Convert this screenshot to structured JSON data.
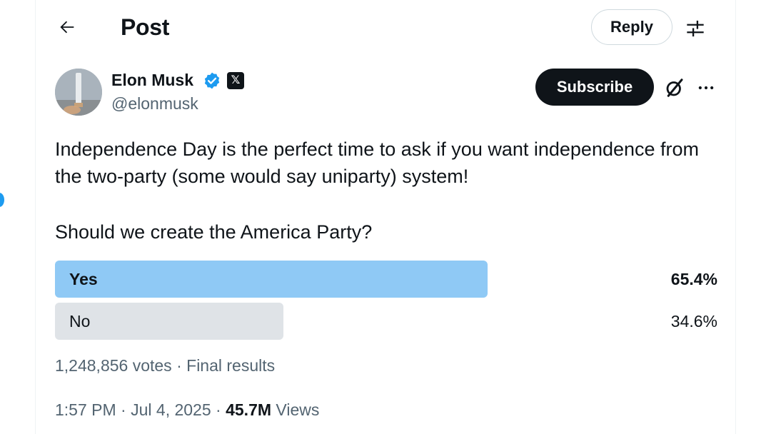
{
  "header": {
    "title": "Post",
    "reply_label": "Reply"
  },
  "author": {
    "name": "Elon Musk",
    "handle": "@elonmusk",
    "affiliate_badge": "𝕏",
    "subscribe_label": "Subscribe"
  },
  "post": {
    "paragraphs": [
      "Independence Day is the perfect time to ask if you want independence from the two-party (some would say uniparty) system!",
      "Should we create the America Party?"
    ]
  },
  "poll": {
    "options": [
      {
        "label": "Yes",
        "percent": "65.4%",
        "fraction": 0.654,
        "winner": true
      },
      {
        "label": "No",
        "percent": "34.6%",
        "fraction": 0.346,
        "winner": false
      }
    ],
    "votes": "1,248,856 votes",
    "separator": "·",
    "status": "Final results"
  },
  "meta": {
    "time": "1:57 PM",
    "date": "Jul 4, 2025",
    "separator": "·",
    "views_count": "45.7M",
    "views_label": "Views"
  },
  "icons": {
    "back": "arrow-left-icon",
    "filter": "sliders-icon",
    "verified": "verified-badge-icon",
    "grok": "grok-icon",
    "more": "more-horizontal-icon"
  },
  "colors": {
    "text_primary": "#0f1419",
    "text_secondary": "#536471",
    "verified_blue": "#1d9bf0",
    "poll_winner": "#8fc9f5",
    "poll_other": "#dfe3e7",
    "button_dark": "#0f1419"
  }
}
